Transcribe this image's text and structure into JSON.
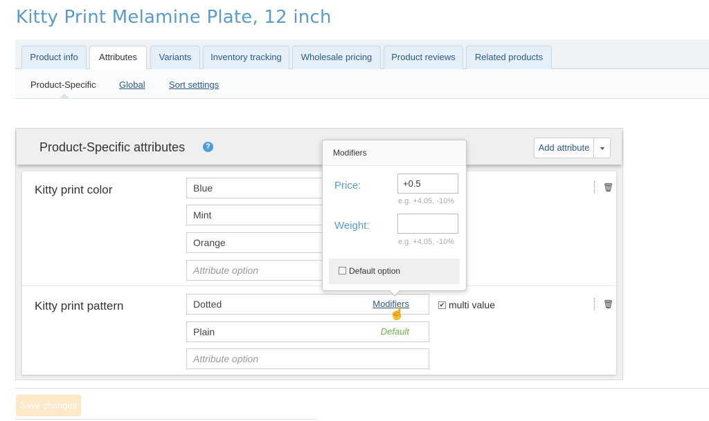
{
  "page_title": "Kitty Print Melamine Plate, 12 inch",
  "tabs": [
    {
      "label": "Product info"
    },
    {
      "label": "Attributes"
    },
    {
      "label": "Variants"
    },
    {
      "label": "Inventory tracking"
    },
    {
      "label": "Wholesale pricing"
    },
    {
      "label": "Product reviews"
    },
    {
      "label": "Related products"
    }
  ],
  "subnav": {
    "active": "Product-Specific",
    "global": "Global",
    "sort": "Sort settings"
  },
  "panel": {
    "title": "Product-Specific attributes",
    "help_glyph": "?",
    "add_button": "Add attribute"
  },
  "attributes": [
    {
      "name": "Kitty print color",
      "options": [
        "Blue",
        "Mint",
        "Orange"
      ],
      "placeholder": "Attribute option"
    },
    {
      "name": "Kitty print pattern",
      "options": [
        "Dotted",
        "Plain"
      ],
      "placeholder": "Attribute option",
      "modifiers_link": "Modifiers",
      "default_label": "Default",
      "multi_value_label": "multi value",
      "multi_value_checked": true
    }
  ],
  "popover": {
    "title": "Modifiers",
    "price_label": "Price:",
    "price_value": "+0.5",
    "price_hint": "e.g. +4.05, -10%",
    "weight_label": "Weight:",
    "weight_value": "",
    "weight_hint": "e.g. +4.05, -10%",
    "default_option_label": "Default option",
    "default_option_checked": false
  },
  "footer": {
    "save_label": "Save changes"
  },
  "colors": {
    "title": "#5b9bc8",
    "link": "#2c5a85",
    "default_green": "#6ab04c",
    "save_disabled": "#fde8c8"
  }
}
